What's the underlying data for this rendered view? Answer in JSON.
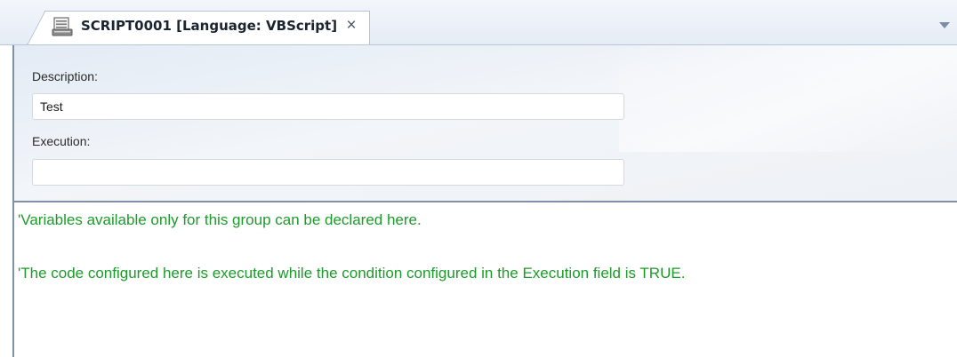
{
  "tab": {
    "title": "SCRIPT0001 [Language: VBScript]",
    "close_glyph": "×",
    "icon": "script-document-icon",
    "dropdown_icon": "chevron-down-icon"
  },
  "form": {
    "description_label": "Description:",
    "description_value": "Test",
    "execution_label": "Execution:",
    "execution_value": ""
  },
  "editor": {
    "lines": [
      "'Variables available only for this group can be declared here.",
      "'The code configured here is executed while the condition configured in the Execution field is TRUE."
    ],
    "comment_color": "#1c9b2a"
  }
}
